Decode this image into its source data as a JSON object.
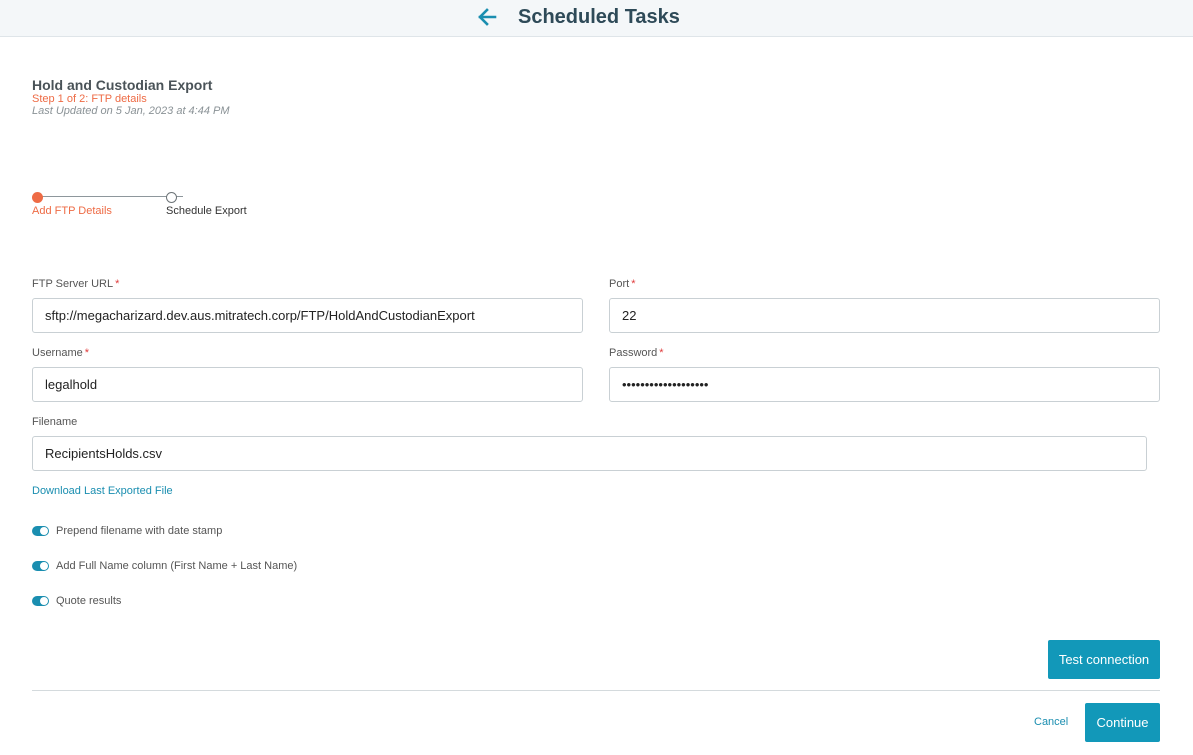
{
  "header": {
    "title": "Scheduled Tasks",
    "back_icon": "arrow-left-icon"
  },
  "task": {
    "title": "Hold and Custodian Export",
    "step": "Step 1 of 2: FTP details",
    "last_updated": "Last Updated on 5 Jan, 2023 at 4:44 PM"
  },
  "stepper": {
    "steps": [
      {
        "label": "Add FTP Details",
        "active": true
      },
      {
        "label": "Schedule Export",
        "active": false
      }
    ]
  },
  "form": {
    "required_mark": "*",
    "ftp_url": {
      "label": "FTP Server URL",
      "value": "sftp://megacharizard.dev.aus.mitratech.corp/FTP/HoldAndCustodianExport"
    },
    "port": {
      "label": "Port",
      "value": "22"
    },
    "username": {
      "label": "Username",
      "value": "legalhold"
    },
    "password": {
      "label": "Password",
      "value": "•••••••••••••••••••"
    },
    "filename": {
      "label": "Filename",
      "value": "RecipientsHolds.csv"
    },
    "download_link": "Download Last Exported File",
    "toggles": [
      {
        "label": "Prepend filename with date stamp",
        "on": true
      },
      {
        "label": "Add Full Name column (First Name + Last Name)",
        "on": true
      },
      {
        "label": "Quote results",
        "on": true
      }
    ]
  },
  "actions": {
    "test_connection": "Test connection",
    "cancel": "Cancel",
    "continue": "Continue"
  },
  "colors": {
    "accent": "#1298b9",
    "step_active": "#ee6b45",
    "title": "#2e4a58"
  }
}
